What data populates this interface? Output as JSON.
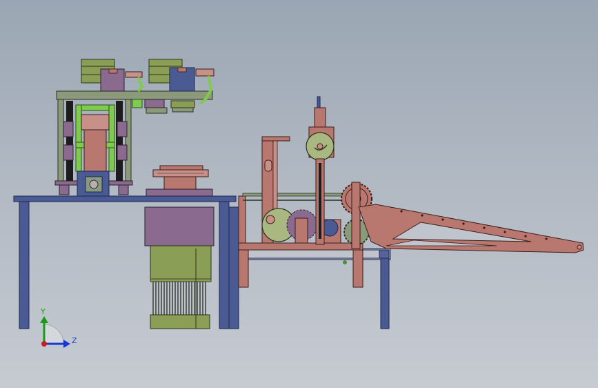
{
  "axes_triad": {
    "y_label": "Y",
    "z_label": "Z",
    "y_color": "#1a9a1a",
    "z_color": "#1a3acc",
    "origin_color": "#c81e1e"
  },
  "colors": {
    "background_top": "#9aa6b3",
    "background_bottom": "#c6cbd2",
    "table_frame": "#4a5a92",
    "motor_green": "#8a9e56",
    "copper": "#b87870",
    "purple": "#8a6a8e",
    "olive_plate": "#8c9a7c",
    "bright_green": "#7ecb4e"
  }
}
